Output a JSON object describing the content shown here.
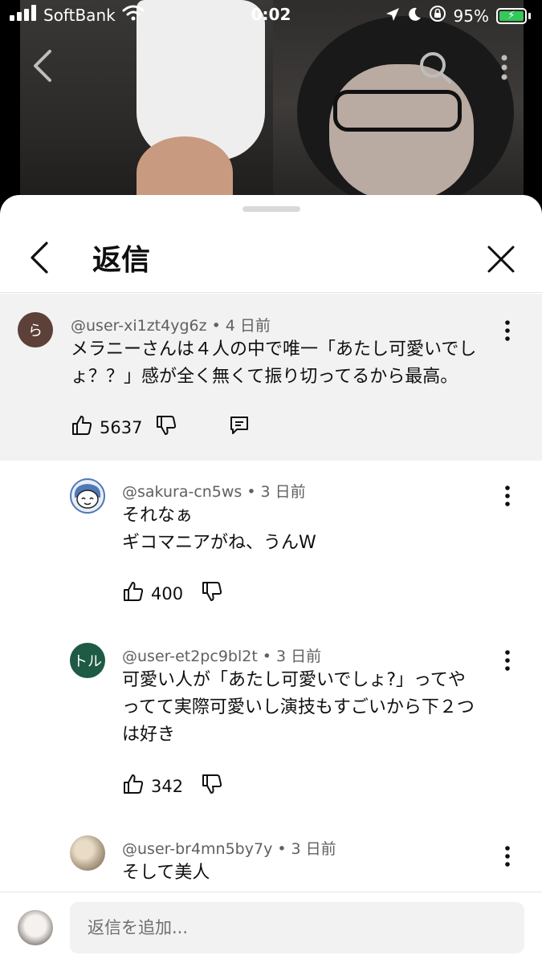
{
  "status_bar": {
    "carrier": "SoftBank",
    "time": "0:02",
    "battery": "95%",
    "icons": [
      "signal-icon",
      "wifi-icon",
      "location-icon",
      "moon-icon",
      "rotation-lock-icon",
      "battery-icon"
    ]
  },
  "video_icons": [
    "back-icon",
    "search-icon",
    "more-icon"
  ],
  "sheet": {
    "title": "返信",
    "icons": [
      "chevron-left-icon",
      "close-icon"
    ]
  },
  "parent_comment": {
    "avatar_text": "ら",
    "avatar_color": "#5d4037",
    "author": "@user-xi1zt4yg6z",
    "time": "4 日前",
    "text": "メラニーさんは４人の中で唯一「あたし可愛いでしょ？？」感が全く無くて振り切ってるから最高。",
    "likes": "5637"
  },
  "replies": [
    {
      "author": "@sakura-cn5ws",
      "time": "3 日前",
      "text_lines": [
        "それなぁ",
        "ギコマニアがね、うんW"
      ],
      "likes": "400",
      "avatar_text": "",
      "avatar_color": "#e8eef6"
    },
    {
      "author": "@user-et2pc9bl2t",
      "time": "3 日前",
      "text_lines": [
        "可愛い人が「あたし可愛いでしょ?」ってや",
        "ってて実際可愛いし演技もすごいから下２つ",
        "は好き"
      ],
      "likes": "342",
      "avatar_text": "トル",
      "avatar_color": "#1e5a44"
    },
    {
      "author": "@user-br4mn5by7y",
      "time": "3 日前",
      "text_lines": [
        "そして美人"
      ],
      "likes": "",
      "avatar_text": "",
      "avatar_color": "#b8a890"
    }
  ],
  "reply_input": {
    "placeholder": "返信を追加..."
  },
  "colors": {
    "parent_bg": "#f2f2f2",
    "text": "#0f0f0f",
    "meta": "#606060",
    "battery_green": "#34c759"
  }
}
